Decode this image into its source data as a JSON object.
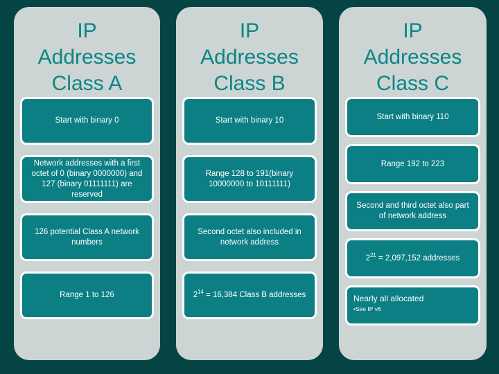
{
  "slide": {
    "background_color": "#044444",
    "panel_color": "#ccd5d3",
    "box_color": "#0c7f84",
    "title_color": "#0a8686",
    "box_text_color": "#ffffff"
  },
  "columns": [
    {
      "id": "class-a",
      "title": "IP\nAddresses\nClass A",
      "boxes": [
        {
          "text": "Start with binary 0"
        },
        {
          "text": "Network addresses with a first octet of 0 (binary 0000000) and 127 (binary 01111111) are reserved"
        },
        {
          "text": "126 potential Class A network numbers"
        },
        {
          "text": "Range 1 to 126"
        }
      ]
    },
    {
      "id": "class-b",
      "title": "IP\nAddresses\nClass B",
      "boxes": [
        {
          "text": "Start with binary 10"
        },
        {
          "text": "Range 128 to 191(binary 10000000 to 10111111)"
        },
        {
          "text": "Second octet also included in network address"
        },
        {
          "text": "2",
          "sup": "14",
          "text_after": " = 16,384 Class B addresses"
        }
      ]
    },
    {
      "id": "class-c",
      "title": "IP\nAddresses\nClass C",
      "boxes": [
        {
          "text": "Start with binary 110"
        },
        {
          "text": "Range 192 to 223"
        },
        {
          "text": "Second and third octet also part of network address"
        },
        {
          "text": "2",
          "sup": "21",
          "text_after": " = 2,097,152 addresses"
        },
        {
          "head": "Nearly all allocated",
          "bullet_symbol": "▪",
          "bullet": "See IP v6"
        }
      ]
    }
  ]
}
